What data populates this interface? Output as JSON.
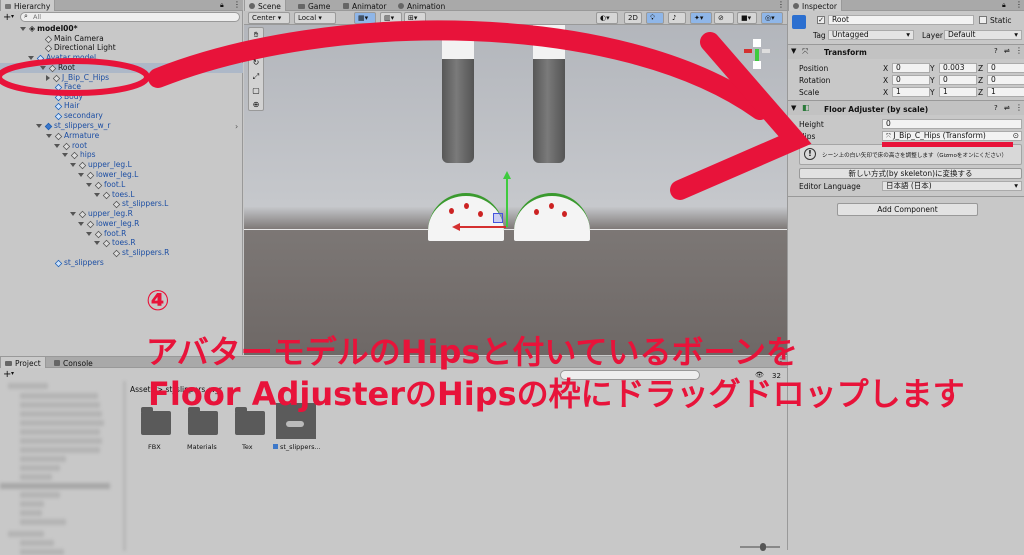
{
  "hierarchy": {
    "tab": "Hierarchy",
    "search_placeholder": "All",
    "items": [
      {
        "label": "model00*"
      },
      {
        "label": "Main Camera"
      },
      {
        "label": "Directional Light"
      },
      {
        "label": "Avatar model"
      },
      {
        "label": "Root"
      },
      {
        "label": "J_Bip_C_Hips"
      },
      {
        "label": "Face"
      },
      {
        "label": "Body"
      },
      {
        "label": "Hair"
      },
      {
        "label": "secondary"
      },
      {
        "label": "st_slippers_w_r"
      },
      {
        "label": "Armature"
      },
      {
        "label": "root"
      },
      {
        "label": "hips"
      },
      {
        "label": "upper_leg.L"
      },
      {
        "label": "lower_leg.L"
      },
      {
        "label": "foot.L"
      },
      {
        "label": "toes.L"
      },
      {
        "label": "st_slippers.L"
      },
      {
        "label": "upper_leg.R"
      },
      {
        "label": "lower_leg.R"
      },
      {
        "label": "foot.R"
      },
      {
        "label": "toes.R"
      },
      {
        "label": "st_slippers.R"
      },
      {
        "label": "st_slippers"
      }
    ]
  },
  "scene_tabs": [
    "Scene",
    "Game",
    "Animator",
    "Animation"
  ],
  "scene_toolbar": {
    "pivot": "Center",
    "space": "Local",
    "mode_2d": "2D"
  },
  "inspector": {
    "tab": "Inspector",
    "object_name": "Root",
    "static_label": "Static",
    "tag_label": "Tag",
    "tag_value": "Untagged",
    "layer_label": "Layer",
    "layer_value": "Default",
    "transform": {
      "title": "Transform",
      "position": {
        "label": "Position",
        "x": "0",
        "y": "0.003",
        "z": "0"
      },
      "rotation": {
        "label": "Rotation",
        "x": "0",
        "y": "0",
        "z": "0"
      },
      "scale": {
        "label": "Scale",
        "x": "1",
        "y": "1",
        "z": "1"
      }
    },
    "floor_adjuster": {
      "title": "Floor Adjuster (by scale)",
      "height_label": "Height",
      "height_value": "0",
      "hips_label": "Hips",
      "hips_value": "J_Bip_C_Hips (Transform)",
      "help_text": "シーン上の白い矢印で床の高さを調整します（Gizmoをオンにください）",
      "convert_button": "新しい方式(by skeleton)に変換する",
      "editor_language_label": "Editor Language",
      "editor_language_value": "日本語 (日本)"
    },
    "add_component": "Add Component"
  },
  "project": {
    "tab_project": "Project",
    "tab_console": "Console",
    "breadcrumb": "Assets > st_slippers_w_r",
    "count": "32",
    "assets": [
      {
        "label": "FBX"
      },
      {
        "label": "Materials"
      },
      {
        "label": "Tex"
      },
      {
        "label": "st_slippers..."
      }
    ]
  },
  "annotation": {
    "step": "④",
    "line1": "アバターモデルのHipsと付いているボーンを",
    "line2": "Floor AdjusterのHipsの枠にドラッグドロップします",
    "color": "#e8133a"
  },
  "x_labels": {
    "x": "X",
    "y": "Y",
    "z": "Z"
  }
}
